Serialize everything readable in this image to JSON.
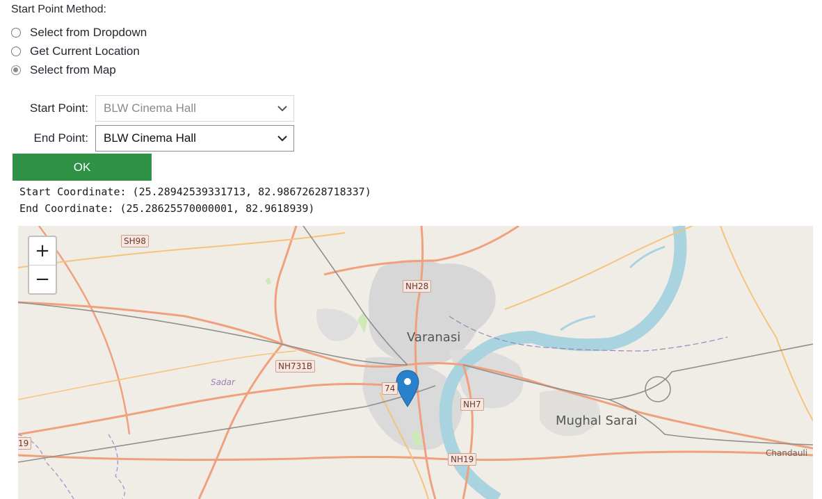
{
  "form": {
    "method_title": "Start Point Method:",
    "options": [
      {
        "label": "Select from Dropdown",
        "selected": false
      },
      {
        "label": "Get Current Location",
        "selected": false
      },
      {
        "label": "Select from Map",
        "selected": true
      }
    ],
    "start_label": "Start Point:",
    "start_value": "BLW Cinema Hall",
    "end_label": "End Point:",
    "end_value": "BLW Cinema Hall",
    "ok_label": "OK",
    "start_coordinate": "Start Coordinate: (25.28942539331713, 82.98672628718337)",
    "end_coordinate": "End Coordinate: (25.28625570000001, 82.9618939)"
  },
  "map": {
    "zoom_in": "+",
    "zoom_out": "−",
    "city": "Varanasi",
    "town": "Mughal Sarai",
    "place_sadar": "Sadar",
    "place_chandauli": "Chandauli",
    "shields": {
      "sh98": "SH98",
      "nh28": "NH28",
      "nh731b": "NH731B",
      "n74": "74",
      "nh7": "NH7",
      "nh19": "NH19",
      "n19": "19"
    },
    "colors": {
      "road_major": "#f0a07c",
      "road_minor": "#f6c37a",
      "river": "#a9d3de",
      "urban": "#d9d9d9",
      "marker": "#2a81cb"
    }
  }
}
